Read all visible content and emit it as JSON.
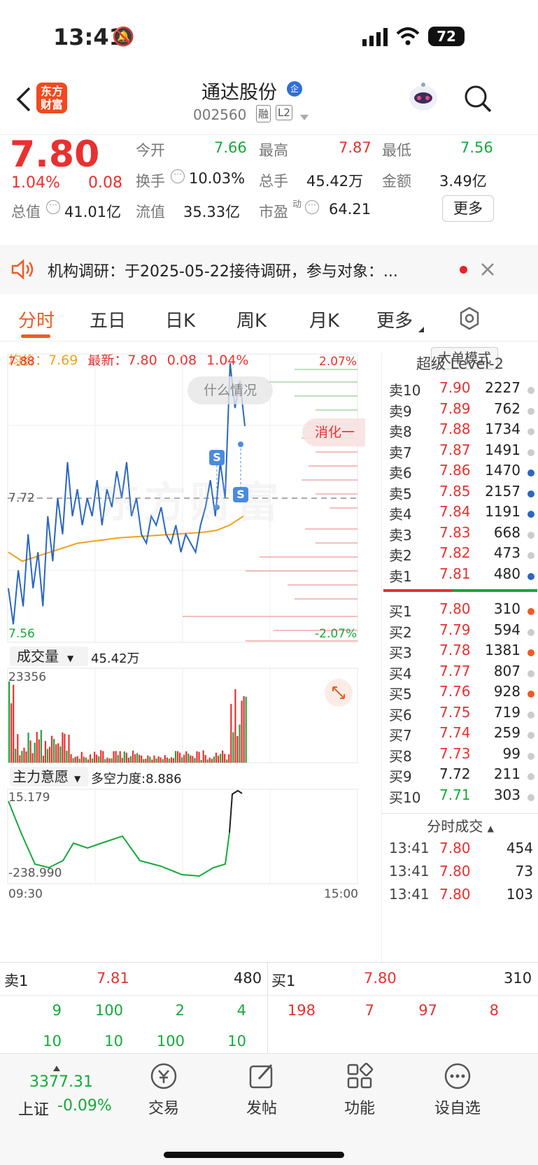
{
  "status": {
    "time": "13:41",
    "battery": "72"
  },
  "header": {
    "title": "通达股份",
    "badge": "企",
    "code": "002560",
    "tag1": "融",
    "tag2": "L2",
    "logo_line1": "东方",
    "logo_line2": "财富"
  },
  "quote": {
    "price": "7.80",
    "pct": "1.04%",
    "chg": "0.08",
    "open_label": "今开",
    "open": "7.66",
    "high_label": "最高",
    "high": "7.87",
    "low_label": "最低",
    "low": "7.56",
    "turnover_label": "换手",
    "turnover": "10.03%",
    "vol_label": "总手",
    "vol": "45.42万",
    "amt_label": "金额",
    "amt": "3.49亿",
    "mcap_label": "总值",
    "mcap": "41.01亿",
    "float_label": "流值",
    "float": "35.33亿",
    "pe_label": "市盈",
    "pe_sup": "动",
    "pe": "64.21",
    "more": "更多"
  },
  "notice": {
    "text": "机构调研：于2025-05-22接待调研，参与对象：..."
  },
  "tabs": [
    "分时",
    "五日",
    "日K",
    "周K",
    "月K",
    "更多"
  ],
  "info": {
    "avg_label": "均价：",
    "avg": "7.69",
    "latest_label": "最新：",
    "latest": "7.80",
    "chg": "0.08",
    "pct": "1.04%",
    "mode_btn": "大单模式"
  },
  "chart": {
    "ymax": "7.88",
    "ymin": "7.56",
    "ymid": "7.72",
    "pmax": "2.07%",
    "pmin": "-2.07%",
    "bubble1": "什么情况",
    "bubble2": "消化一",
    "marker": "S",
    "watermark": "东方财富"
  },
  "volume": {
    "label": "成交量",
    "total": "45.42万",
    "max": "23356"
  },
  "main_force": {
    "label": "主力意愿",
    "ratio": "多空力度:8.886",
    "max": "15.179",
    "min": "-238.990",
    "t_start": "09:30",
    "t_end": "15:00"
  },
  "level2": {
    "title": "超级 Level-2",
    "asks": [
      [
        "卖10",
        "7.90",
        "2227"
      ],
      [
        "卖9",
        "7.89",
        "762"
      ],
      [
        "卖8",
        "7.88",
        "1734"
      ],
      [
        "卖7",
        "7.87",
        "1491"
      ],
      [
        "卖6",
        "7.86",
        "1470"
      ],
      [
        "卖5",
        "7.85",
        "2157"
      ],
      [
        "卖4",
        "7.84",
        "1191"
      ],
      [
        "卖3",
        "7.83",
        "668"
      ],
      [
        "卖2",
        "7.82",
        "473"
      ],
      [
        "卖1",
        "7.81",
        "480"
      ]
    ],
    "bids": [
      [
        "买1",
        "7.80",
        "310"
      ],
      [
        "买2",
        "7.79",
        "594"
      ],
      [
        "买3",
        "7.78",
        "1381"
      ],
      [
        "买4",
        "7.77",
        "807"
      ],
      [
        "买5",
        "7.76",
        "928"
      ],
      [
        "买6",
        "7.75",
        "719"
      ],
      [
        "买7",
        "7.74",
        "259"
      ],
      [
        "买8",
        "7.73",
        "99"
      ],
      [
        "买9",
        "7.72",
        "211"
      ],
      [
        "买10",
        "7.71",
        "303"
      ]
    ],
    "ticks_title": "分时成交",
    "ticks": [
      [
        "13:41",
        "7.80",
        "454"
      ],
      [
        "13:41",
        "7.80",
        "73"
      ],
      [
        "13:41",
        "7.80",
        "103"
      ]
    ]
  },
  "book": {
    "ask_label": "卖1",
    "ask_price": "7.81",
    "ask_vol": "480",
    "bid_label": "买1",
    "bid_price": "7.80",
    "bid_vol": "310",
    "ask_q1": [
      "9",
      "100",
      "2",
      "4"
    ],
    "ask_q2": [
      "10",
      "10",
      "100",
      "10"
    ],
    "bid_q1": [
      "198",
      "7",
      "97",
      "8"
    ]
  },
  "nav": {
    "index_value": "3377.31",
    "index_name": "上证",
    "index_pct": "-0.09%",
    "items": [
      "交易",
      "发帖",
      "功能",
      "设自选"
    ]
  }
}
